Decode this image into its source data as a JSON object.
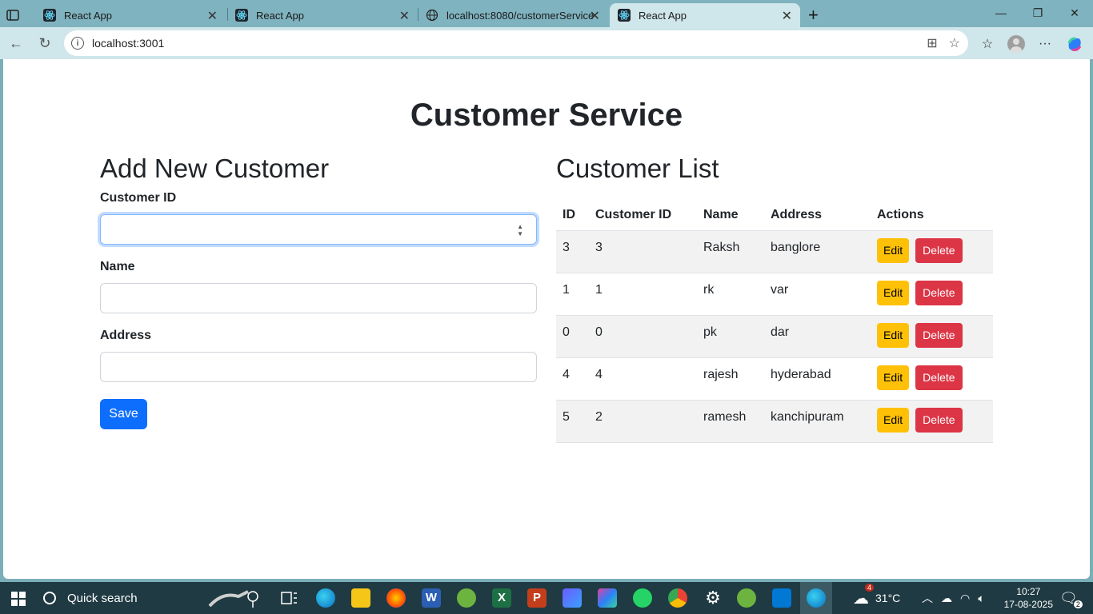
{
  "browser": {
    "tabs": [
      {
        "title": "React App"
      },
      {
        "title": "React App"
      },
      {
        "title": "localhost:8080/customerService"
      },
      {
        "title": "React App"
      }
    ],
    "url": "localhost:3001"
  },
  "page": {
    "title": "Customer Service",
    "form": {
      "heading": "Add New Customer",
      "customer_id_label": "Customer ID",
      "customer_id_value": "",
      "name_label": "Name",
      "name_value": "",
      "address_label": "Address",
      "address_value": "",
      "save_label": "Save"
    },
    "list": {
      "heading": "Customer List",
      "columns": [
        "ID",
        "Customer ID",
        "Name",
        "Address",
        "Actions"
      ],
      "rows": [
        {
          "id": "3",
          "customer_id": "3",
          "name": "Raksh",
          "address": "banglore"
        },
        {
          "id": "1",
          "customer_id": "1",
          "name": "rk",
          "address": "var"
        },
        {
          "id": "0",
          "customer_id": "0",
          "name": "pk",
          "address": "dar"
        },
        {
          "id": "4",
          "customer_id": "4",
          "name": "rajesh",
          "address": "hyderabad"
        },
        {
          "id": "5",
          "customer_id": "2",
          "name": "ramesh",
          "address": "kanchipuram"
        }
      ],
      "edit_label": "Edit",
      "delete_label": "Delete"
    }
  },
  "taskbar": {
    "search_label": "Quick search",
    "weather": "31°C",
    "weather_badge": "4",
    "time": "10:27",
    "date": "17-08-2025",
    "notifications": "2"
  },
  "colors": {
    "primary": "#0d6efd",
    "warning": "#ffc107",
    "danger": "#dc3545"
  }
}
